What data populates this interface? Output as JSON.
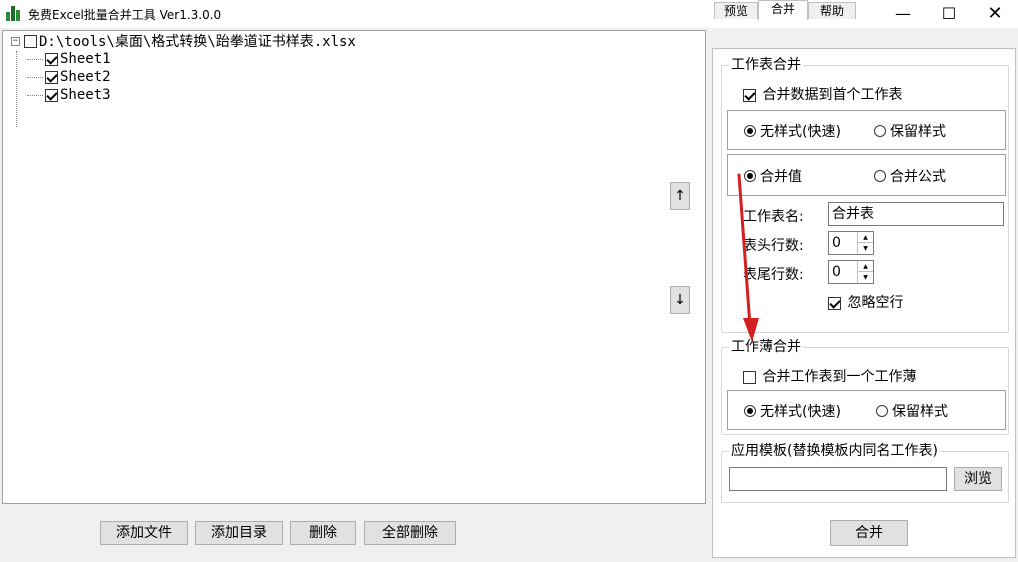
{
  "window": {
    "title": "免费Excel批量合并工具 Ver1.3.0.0",
    "minimize": "—",
    "maximize": "☐",
    "close": "✕"
  },
  "tree": {
    "root": {
      "label": "D:\\tools\\桌面\\格式转换\\跆拳道证书样表.xlsx",
      "checked": false,
      "expander": "−"
    },
    "sheets": [
      {
        "label": "Sheet1",
        "checked": true
      },
      {
        "label": "Sheet2",
        "checked": true
      },
      {
        "label": "Sheet3",
        "checked": true
      }
    ]
  },
  "reorder": {
    "up": "↑",
    "down": "↓"
  },
  "buttons": {
    "add_file": "添加文件",
    "add_dir": "添加目录",
    "delete": "删除",
    "delete_all": "全部删除",
    "merge": "合并",
    "browse": "浏览"
  },
  "tabs": [
    {
      "label": "预览",
      "active": false
    },
    {
      "label": "合并",
      "active": true
    },
    {
      "label": "帮助",
      "active": false
    }
  ],
  "sheet_merge": {
    "title": "工作表合并",
    "merge_to_first": {
      "label": "合并数据到首个工作表",
      "checked": true
    },
    "style_options": {
      "no_style": "无样式(快速)",
      "keep_style": "保留样式",
      "selected": "no_style"
    },
    "value_options": {
      "merge_value": "合并值",
      "merge_formula": "合并公式",
      "selected": "merge_value"
    },
    "sheet_name_label": "工作表名:",
    "sheet_name_value": "合并表",
    "header_rows_label": "表头行数:",
    "header_rows_value": "0",
    "footer_rows_label": "表尾行数:",
    "footer_rows_value": "0",
    "ignore_blank": {
      "label": "忽略空行",
      "checked": true
    }
  },
  "workbook_merge": {
    "title": "工作薄合并",
    "merge_to_one": {
      "label": "合并工作表到一个工作薄",
      "checked": false
    },
    "style_options": {
      "no_style": "无样式(快速)",
      "keep_style": "保留样式",
      "selected": "no_style"
    }
  },
  "template": {
    "title": "应用模板(替换模板内同名工作表)",
    "path_value": ""
  },
  "colors": {
    "annotation_arrow": "#d42020",
    "button_face": "#e1e1e1"
  }
}
